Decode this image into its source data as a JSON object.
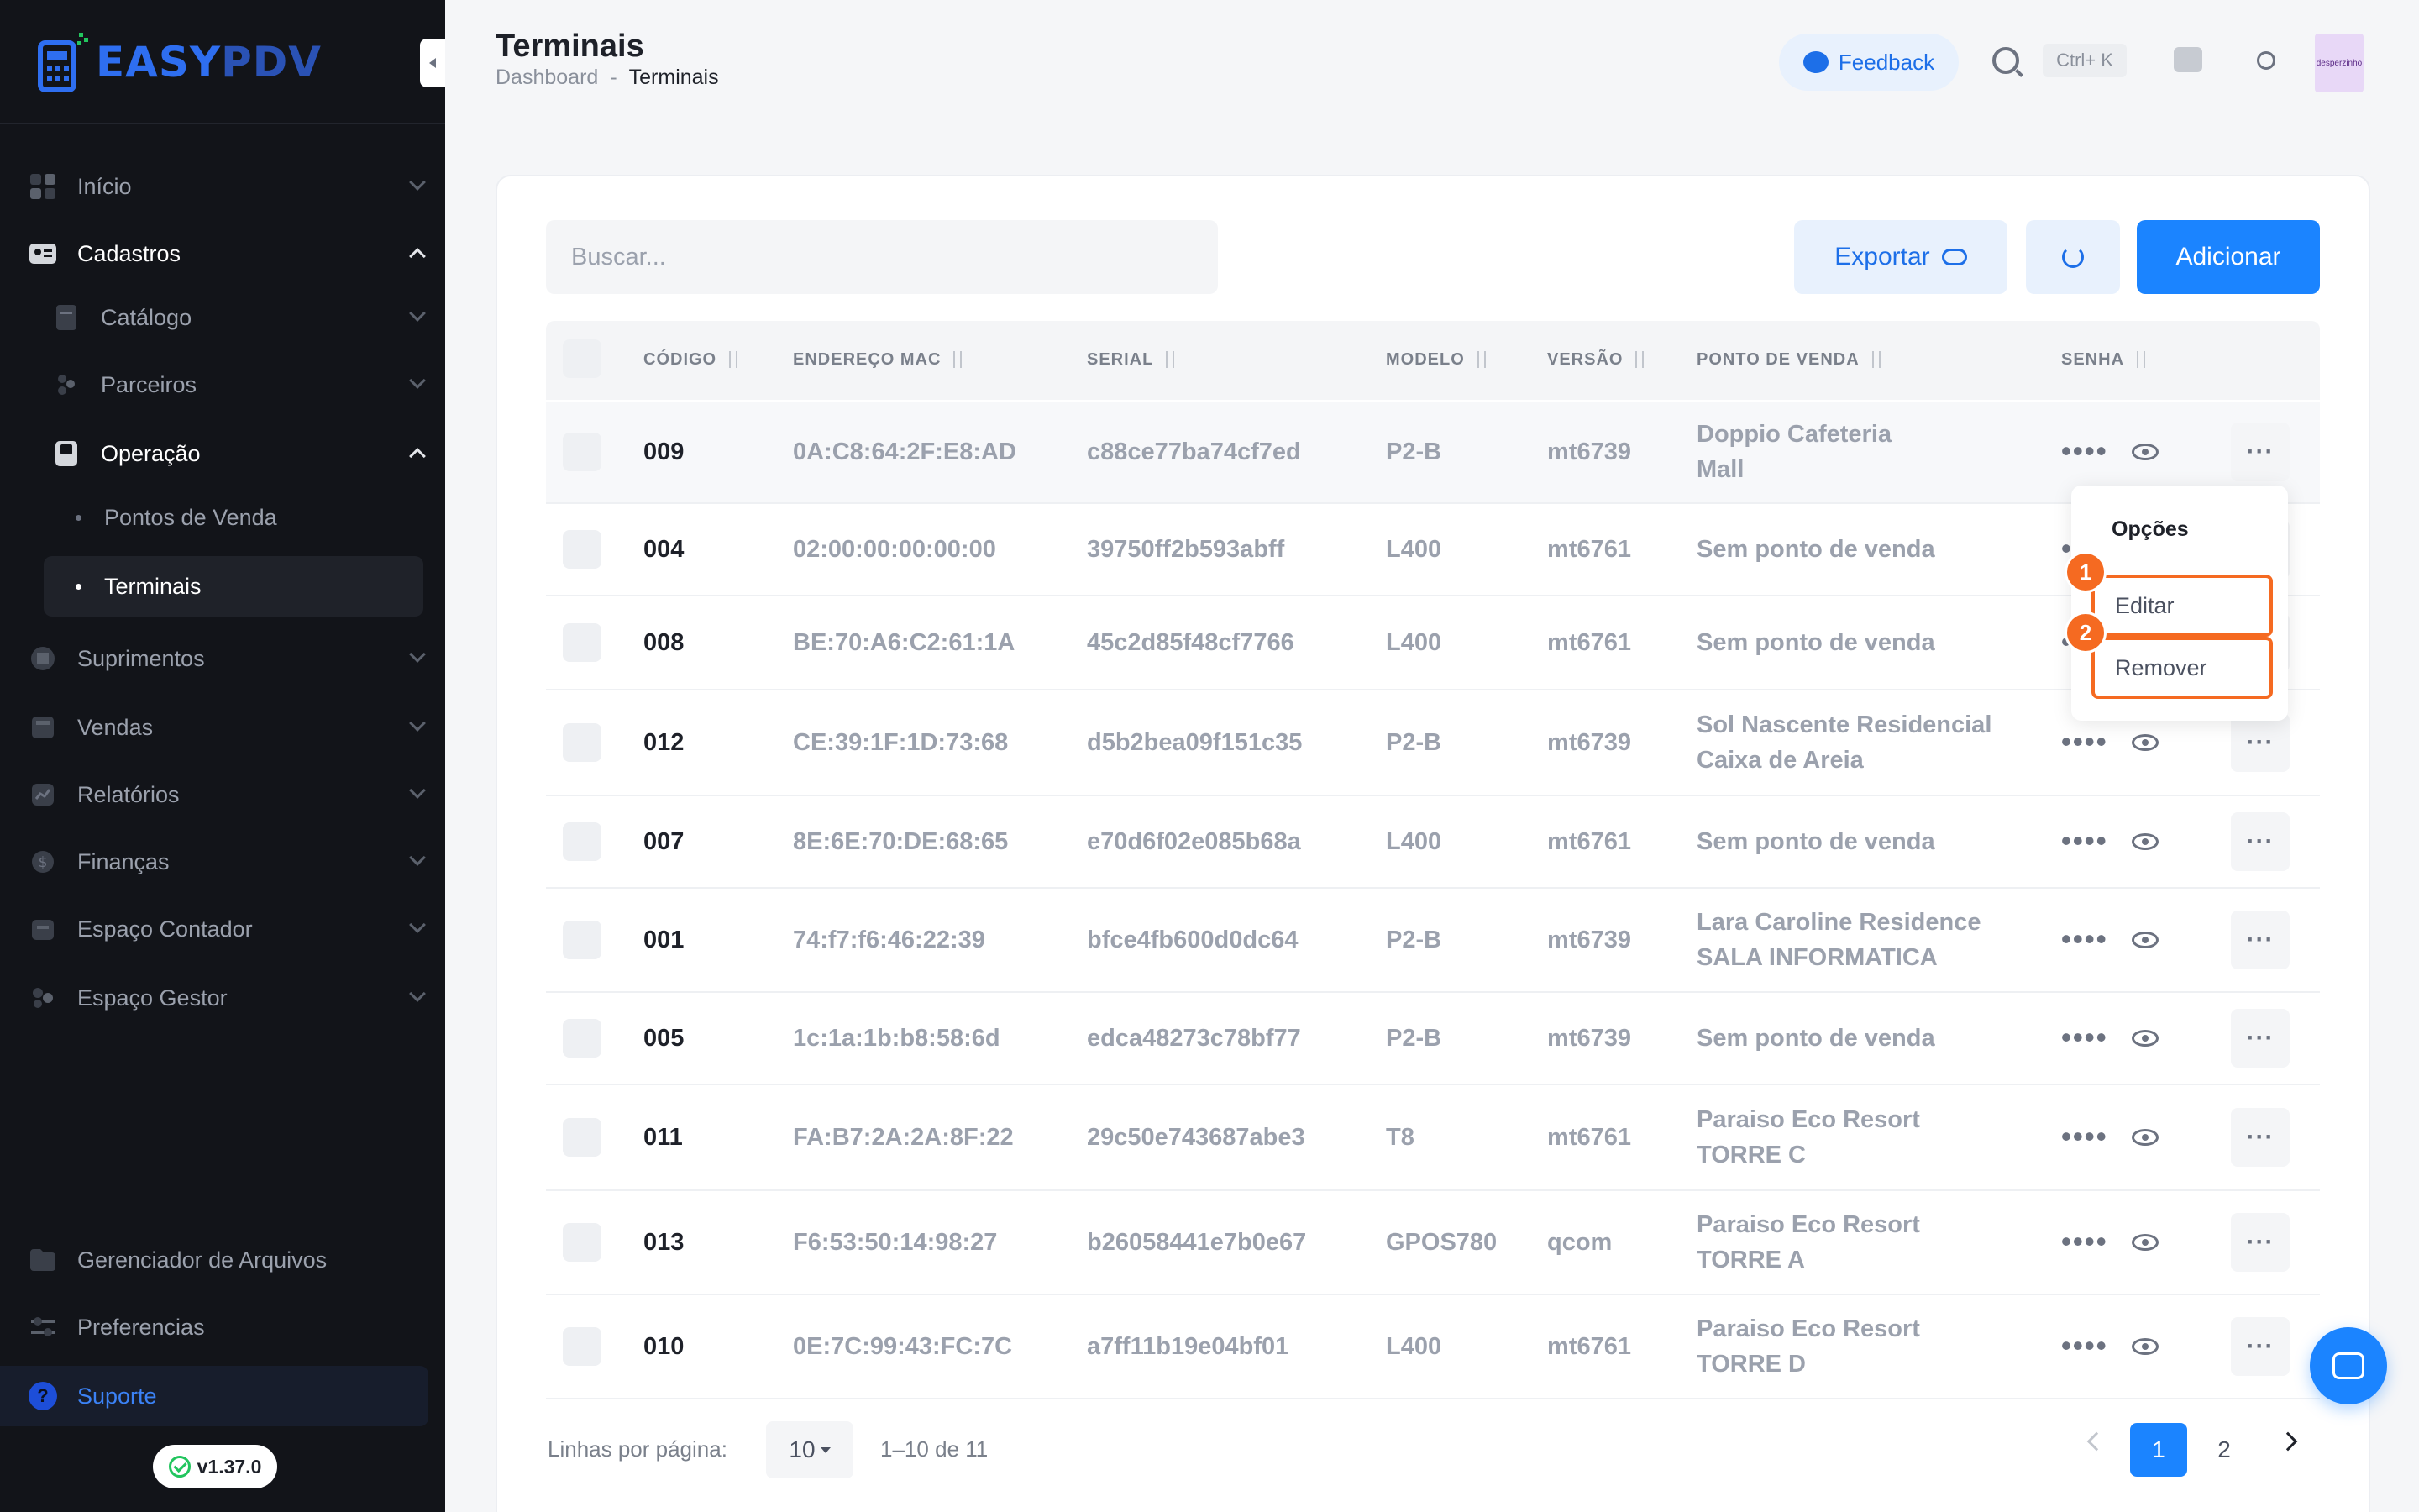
{
  "app": {
    "logo_part1": "EASY",
    "logo_part2": "PDV",
    "version": "v1.37.0"
  },
  "sidebar": {
    "items": [
      {
        "label": "Início",
        "icon": "grid-icon"
      },
      {
        "label": "Cadastros",
        "icon": "id-card-icon"
      },
      {
        "label": "Catálogo",
        "icon": "book-icon"
      },
      {
        "label": "Parceiros",
        "icon": "users-icon"
      },
      {
        "label": "Operação",
        "icon": "pos-terminal-icon"
      },
      {
        "label": "Pontos de Venda"
      },
      {
        "label": "Terminais"
      },
      {
        "label": "Suprimentos",
        "icon": "box-icon"
      },
      {
        "label": "Vendas",
        "icon": "calculator-icon"
      },
      {
        "label": "Relatórios",
        "icon": "chart-icon"
      },
      {
        "label": "Finanças",
        "icon": "dollar-icon"
      },
      {
        "label": "Espaço Contador",
        "icon": "briefcase-icon"
      },
      {
        "label": "Espaço Gestor",
        "icon": "people-icon"
      }
    ],
    "bottom": [
      {
        "label": "Gerenciador de Arquivos",
        "icon": "folder-icon"
      },
      {
        "label": "Preferencias",
        "icon": "sliders-icon"
      },
      {
        "label": "Suporte",
        "icon": "help-icon"
      }
    ]
  },
  "header": {
    "title": "Terminais",
    "breadcrumb": [
      "Dashboard",
      "-",
      "Terminais"
    ],
    "feedback": "Feedback",
    "shortcut": "Ctrl+ K",
    "avatar_text": "desperzinho"
  },
  "toolbar": {
    "search_placeholder": "Buscar...",
    "export": "Exportar",
    "add": "Adicionar"
  },
  "table": {
    "columns": [
      "CÓDIGO",
      "ENDEREÇO MAC",
      "SERIAL",
      "MODELO",
      "VERSÃO",
      "PONTO DE VENDA",
      "SENHA"
    ],
    "rows": [
      {
        "code": "009",
        "mac": "0A:C8:64:2F:E8:AD",
        "serial": "c88ce77ba74cf7ed",
        "model": "P2-B",
        "version": "mt6739",
        "pos1": "Doppio Cafeteria",
        "pos2": "Mall",
        "pass": "••••"
      },
      {
        "code": "004",
        "mac": "02:00:00:00:00:00",
        "serial": "39750ff2b593abff",
        "model": "L400",
        "version": "mt6761",
        "pos1": "Sem ponto de venda",
        "pos2": "",
        "pass": "••••"
      },
      {
        "code": "008",
        "mac": "BE:70:A6:C2:61:1A",
        "serial": "45c2d85f48cf7766",
        "model": "L400",
        "version": "mt6761",
        "pos1": "Sem ponto de venda",
        "pos2": "",
        "pass": "••••"
      },
      {
        "code": "012",
        "mac": "CE:39:1F:1D:73:68",
        "serial": "d5b2bea09f151c35",
        "model": "P2-B",
        "version": "mt6739",
        "pos1": "Sol Nascente Residencial",
        "pos2": "Caixa de Areia",
        "pass": "••••"
      },
      {
        "code": "007",
        "mac": "8E:6E:70:DE:68:65",
        "serial": "e70d6f02e085b68a",
        "model": "L400",
        "version": "mt6761",
        "pos1": "Sem ponto de venda",
        "pos2": "",
        "pass": "••••"
      },
      {
        "code": "001",
        "mac": "74:f7:f6:46:22:39",
        "serial": "bfce4fb600d0dc64",
        "model": "P2-B",
        "version": "mt6739",
        "pos1": "Lara Caroline Residence",
        "pos2": "SALA INFORMATICA",
        "pass": "••••"
      },
      {
        "code": "005",
        "mac": "1c:1a:1b:b8:58:6d",
        "serial": "edca48273c78bf77",
        "model": "P2-B",
        "version": "mt6739",
        "pos1": "Sem ponto de venda",
        "pos2": "",
        "pass": "••••"
      },
      {
        "code": "011",
        "mac": "FA:B7:2A:2A:8F:22",
        "serial": "29c50e743687abe3",
        "model": "T8",
        "version": "mt6761",
        "pos1": "Paraiso Eco Resort",
        "pos2": "TORRE C",
        "pass": "••••"
      },
      {
        "code": "013",
        "mac": "F6:53:50:14:98:27",
        "serial": "b26058441e7b0e67",
        "model": "GPOS780",
        "version": "qcom",
        "pos1": "Paraiso Eco Resort",
        "pos2": "TORRE A",
        "pass": "••••"
      },
      {
        "code": "010",
        "mac": "0E:7C:99:43:FC:7C",
        "serial": "a7ff11b19e04bf01",
        "model": "L400",
        "version": "mt6761",
        "pos1": "Paraiso Eco Resort",
        "pos2": "TORRE D",
        "pass": "••••"
      }
    ]
  },
  "menu": {
    "title": "Opções",
    "items": [
      "Editar",
      "Remover"
    ],
    "badges": [
      "1",
      "2"
    ]
  },
  "footer": {
    "rows_label": "Linhas por página:",
    "rows_value": "10",
    "range": "1–10 de 11",
    "pages": [
      "1",
      "2"
    ]
  },
  "colors": {
    "accent": "#1b84ff",
    "annotation": "#f56a21",
    "sidebar": "#121419"
  }
}
